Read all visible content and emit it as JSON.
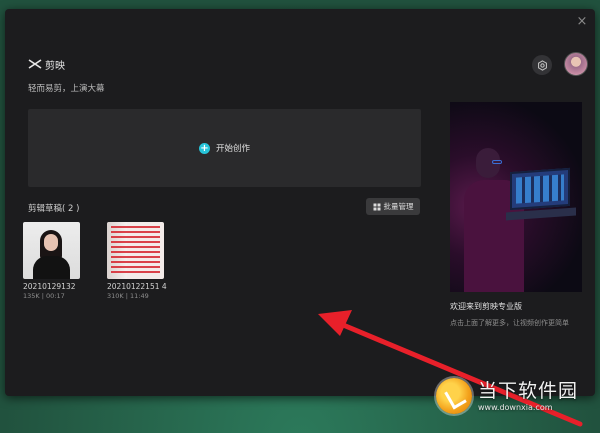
{
  "app": {
    "brand_name": "剪映",
    "slogan": "轻而易剪，上演大幕",
    "icons": {
      "logo": "capcut-logo-icon",
      "settings": "gear-icon",
      "close": "close-icon",
      "avatar": "user-avatar"
    }
  },
  "window": {
    "close_glyph": "×"
  },
  "create": {
    "plus_glyph": "+",
    "label": "开始创作"
  },
  "drafts": {
    "title": "剪辑草稿( 2 )",
    "batch_label": "批量管理",
    "items": [
      {
        "name": "20210129132",
        "meta": "135K | 00:17"
      },
      {
        "name": "20210122151 4",
        "meta": "310K | 11:49"
      }
    ]
  },
  "promo": {
    "title": "欢迎来到剪映专业版",
    "description": "点击上面了解更多，让视频创作更简单"
  },
  "watermark": {
    "name": "当下软件园",
    "url": "www.downxia.com"
  },
  "colors": {
    "accent": "#27c4d9",
    "annotation_arrow": "#e8202a",
    "window_bg": "#1c1c1e",
    "panel_bg": "#2a2a2c"
  }
}
